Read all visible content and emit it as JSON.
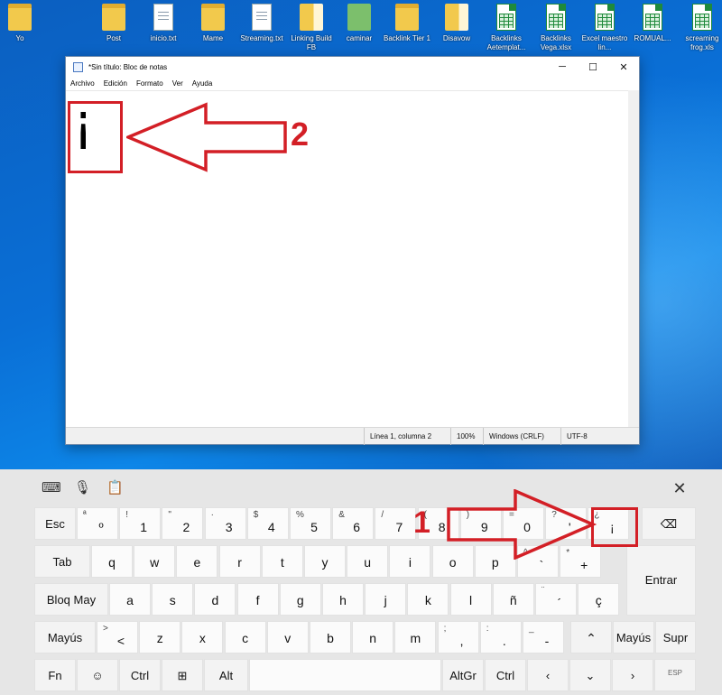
{
  "desktop": {
    "icons": [
      {
        "label": "Yo",
        "type": "folder"
      },
      {
        "label": "Post",
        "type": "folder"
      },
      {
        "label": "inicio.txt",
        "type": "doc"
      },
      {
        "label": "Mame",
        "type": "folder"
      },
      {
        "label": "Streaming.txt",
        "type": "doc"
      },
      {
        "label": "Linking Build FB",
        "type": "folder-open"
      },
      {
        "label": "caminar",
        "type": "green-folder"
      },
      {
        "label": "Backlink Tier 1",
        "type": "folder"
      },
      {
        "label": "Disavow",
        "type": "folder-open"
      },
      {
        "label": "Backlinks Aetemplat...",
        "type": "sheet"
      },
      {
        "label": "Backlinks Vega.xlsx",
        "type": "sheet"
      },
      {
        "label": "Excel maestro lin...",
        "type": "sheet"
      },
      {
        "label": "ROMUAL...",
        "type": "sheet"
      },
      {
        "label": "screaming frog.xls",
        "type": "sheet"
      }
    ]
  },
  "notepad": {
    "title": "*Sin título: Bloc de notas",
    "menu": [
      "Archivo",
      "Edición",
      "Formato",
      "Ver",
      "Ayuda"
    ],
    "content": "¡",
    "status": {
      "position": "Línea 1, columna 2",
      "zoom": "100%",
      "line_ending": "Windows (CRLF)",
      "encoding": "UTF-8"
    },
    "controls": {
      "minimize": "─",
      "maximize": "☐",
      "close": "✕"
    }
  },
  "annotations": {
    "arrow_1": "1",
    "arrow_2": "2",
    "color": "#d31f26"
  },
  "keyboard": {
    "toolbar": {
      "close": "✕"
    },
    "row1": [
      {
        "main": "Esc"
      },
      {
        "sub": "ª",
        "main": "º"
      },
      {
        "sub": "!",
        "main": "1"
      },
      {
        "sub": "\"",
        "main": "2"
      },
      {
        "sub": "·",
        "main": "3"
      },
      {
        "sub": "$",
        "main": "4"
      },
      {
        "sub": "%",
        "main": "5"
      },
      {
        "sub": "&",
        "main": "6"
      },
      {
        "sub": "/",
        "main": "7"
      },
      {
        "sub": "(",
        "main": "8"
      },
      {
        "sub": ")",
        "main": "9"
      },
      {
        "sub": "=",
        "main": "0"
      },
      {
        "sub": "?",
        "main": "'"
      },
      {
        "sub": "¿",
        "main": "¡"
      }
    ],
    "row2": [
      "Tab",
      "q",
      "w",
      "e",
      "r",
      "t",
      "y",
      "u",
      "i",
      "o",
      "p"
    ],
    "row2_extra": [
      {
        "sub": "^",
        "main": "`"
      },
      {
        "sub": "*",
        "main": "+"
      }
    ],
    "row3": [
      "Bloq May",
      "a",
      "s",
      "d",
      "f",
      "g",
      "h",
      "j",
      "k",
      "l",
      "ñ"
    ],
    "row3_extra": [
      {
        "sub": "¨",
        "main": "´"
      },
      {
        "main": "ç"
      }
    ],
    "enter": "Entrar",
    "row4": [
      {
        "main": "Mayús"
      },
      {
        "sub": ">",
        "main": "<"
      },
      {
        "main": "z"
      },
      {
        "main": "x"
      },
      {
        "main": "c"
      },
      {
        "main": "v"
      },
      {
        "main": "b"
      },
      {
        "main": "n"
      },
      {
        "main": "m"
      },
      {
        "sub": ";",
        "main": ","
      },
      {
        "sub": ":",
        "main": "."
      },
      {
        "sub": "_",
        "main": "-"
      },
      {
        "main": "⌃"
      },
      {
        "main": "Mayús"
      },
      {
        "main": "Supr"
      }
    ],
    "row5": [
      {
        "main": "Fn"
      },
      {
        "main": "☺"
      },
      {
        "main": "Ctrl"
      },
      {
        "main": "⊞"
      },
      {
        "main": "Alt"
      },
      {
        "main": ""
      },
      {
        "main": "AltGr"
      },
      {
        "main": "Ctrl"
      },
      {
        "main": "‹"
      },
      {
        "main": "⌄"
      },
      {
        "main": "›"
      },
      {
        "main": "ESP"
      }
    ]
  }
}
